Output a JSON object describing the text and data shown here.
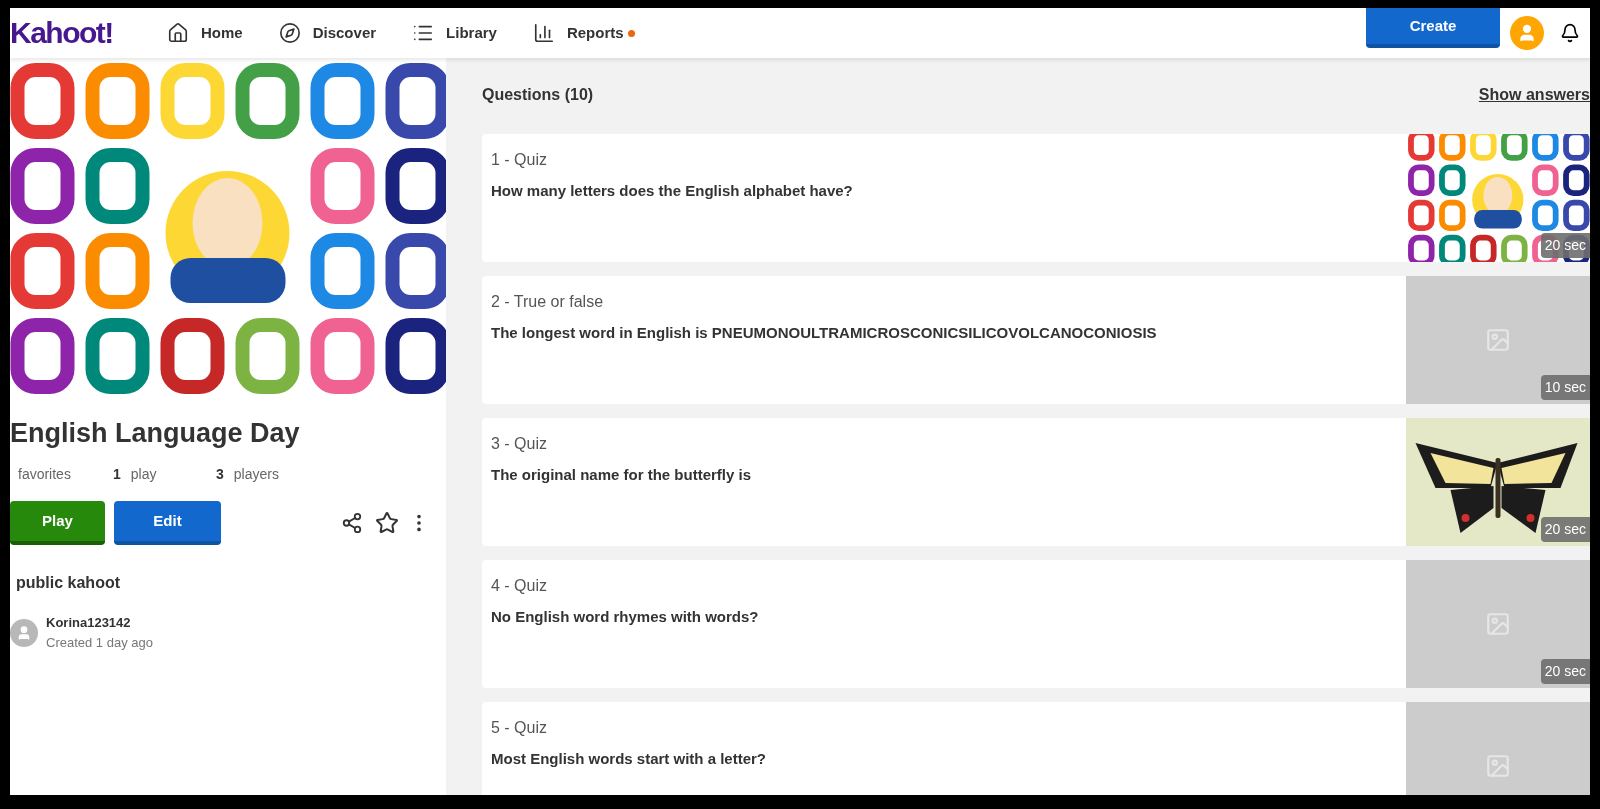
{
  "nav": {
    "logo": "Kahoot!",
    "items": [
      {
        "label": "Home",
        "dot": false
      },
      {
        "label": "Discover",
        "dot": false
      },
      {
        "label": "Library",
        "dot": false
      },
      {
        "label": "Reports",
        "dot": true
      }
    ],
    "create": "Create"
  },
  "kahoot": {
    "title": "English Language Day",
    "stats": [
      {
        "label": "favorites"
      },
      {
        "value": "1",
        "label": "play"
      },
      {
        "value": "3",
        "label": "players"
      }
    ],
    "play": "Play",
    "edit": "Edit",
    "visibility": "public kahoot",
    "author": {
      "name": "Korina123142",
      "created": "Created 1 day ago"
    }
  },
  "questions": {
    "heading": "Questions (10)",
    "show_answers": "Show answers",
    "items": [
      {
        "type": "1 - Quiz",
        "text": "How many letters does the English alphabet have?",
        "kind": "picture",
        "time": "20 sec"
      },
      {
        "type": "2 - True or false",
        "text": "The longest word in English is PNEUMONOULTRAMICROSCONICSILICOVOLCANOCONIOSIS",
        "kind": "placeholder",
        "time": "10 sec"
      },
      {
        "type": "3 - Quiz",
        "text": "The original name for the butterfly is",
        "kind": "picture",
        "time": "20 sec"
      },
      {
        "type": "4 - Quiz",
        "text": "No English word rhymes with words?",
        "kind": "placeholder",
        "time": "20 sec"
      },
      {
        "type": "5 - Quiz",
        "text": "Most English words start with a letter?",
        "kind": "placeholder"
      }
    ]
  }
}
